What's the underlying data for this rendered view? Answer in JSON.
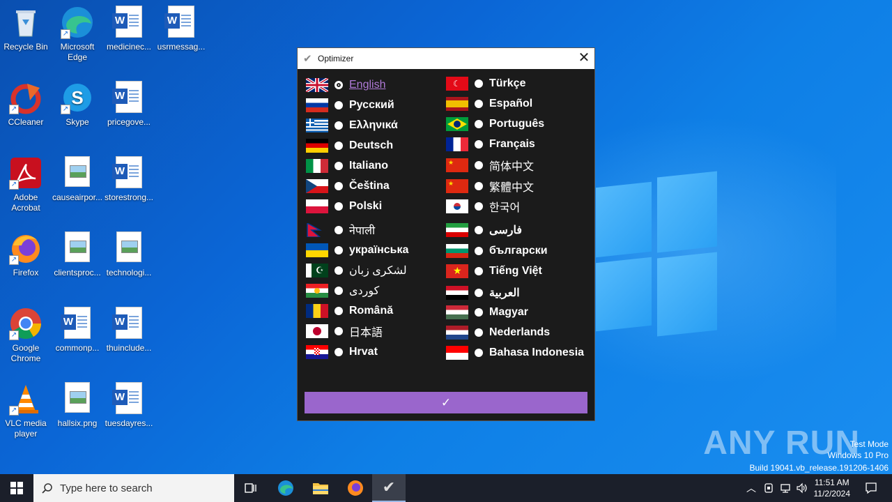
{
  "desktop": {
    "icons": [
      {
        "label": "Recycle Bin"
      },
      {
        "label": "Microsoft Edge"
      },
      {
        "label": "medicinec..."
      },
      {
        "label": "usrmessag..."
      },
      {
        "label": "CCleaner"
      },
      {
        "label": "Skype"
      },
      {
        "label": "pricegove..."
      },
      {
        "label": "Adobe Acrobat"
      },
      {
        "label": "causeairpor..."
      },
      {
        "label": "storestrong..."
      },
      {
        "label": "Firefox"
      },
      {
        "label": "clientsproc..."
      },
      {
        "label": "technologi..."
      },
      {
        "label": "Google Chrome"
      },
      {
        "label": "commonp..."
      },
      {
        "label": "thuinclude..."
      },
      {
        "label": "VLC media player"
      },
      {
        "label": "hallsix.png"
      },
      {
        "label": "tuesdayres..."
      }
    ]
  },
  "dialog": {
    "title": "Optimizer",
    "close": "✕",
    "confirm_label": "✓",
    "left_column": [
      {
        "label": "English",
        "selected": true
      },
      {
        "label": "Русский"
      },
      {
        "label": "Ελληνικά"
      },
      {
        "label": "Deutsch"
      },
      {
        "label": "Italiano"
      },
      {
        "label": "Čeština"
      },
      {
        "label": "Polski"
      },
      {
        "label": "नेपाली"
      },
      {
        "label": "українська"
      },
      {
        "label": "لشکری زبان"
      },
      {
        "label": "کوردی"
      },
      {
        "label": "Română"
      },
      {
        "label": "日本語"
      },
      {
        "label": "Hrvat"
      }
    ],
    "right_column": [
      {
        "label": "Türkçe"
      },
      {
        "label": "Español"
      },
      {
        "label": "Português"
      },
      {
        "label": "Français"
      },
      {
        "label": "简体中文"
      },
      {
        "label": "繁體中文"
      },
      {
        "label": "한국어"
      },
      {
        "label": "فارسی"
      },
      {
        "label": "български"
      },
      {
        "label": "Tiếng Việt"
      },
      {
        "label": "العربية"
      },
      {
        "label": "Magyar"
      },
      {
        "label": "Nederlands"
      },
      {
        "label": "Bahasa Indonesia"
      }
    ]
  },
  "watermark": {
    "brand": "ANY RUN",
    "line1": "Test Mode",
    "line2": "Windows 10 Pro",
    "line3": "Build 19041.vb_release.191206-1406"
  },
  "taskbar": {
    "search_placeholder": "Type here to search",
    "time": "11:51 AM",
    "date": "11/2/2024"
  }
}
